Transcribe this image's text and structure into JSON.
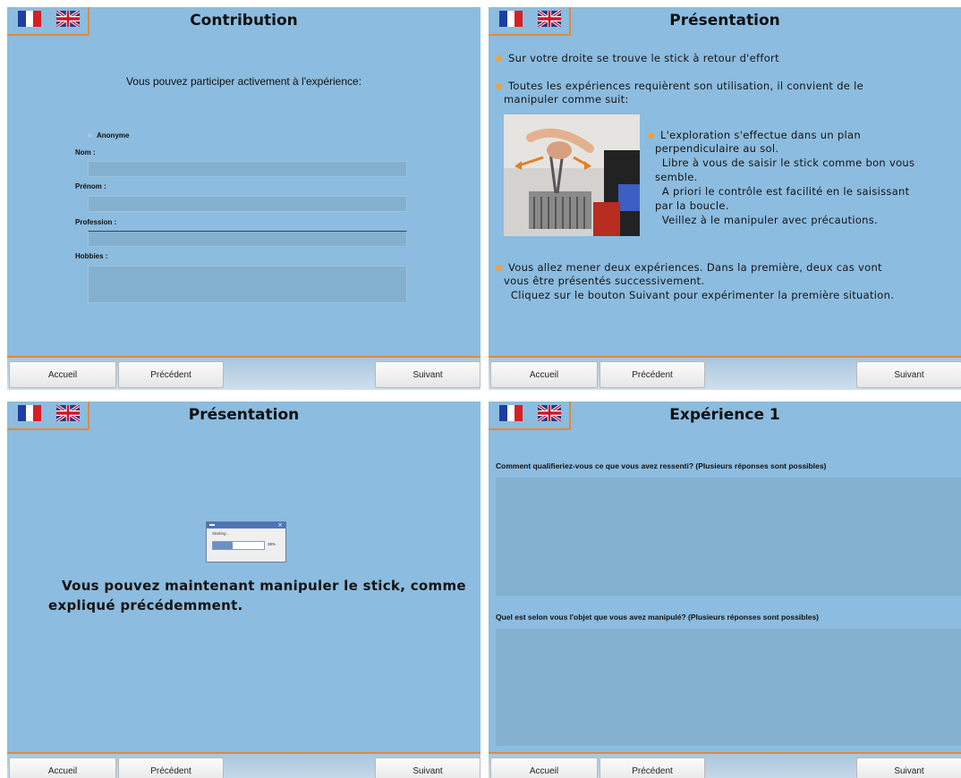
{
  "nav": {
    "home": "Accueil",
    "previous": "Précédent",
    "next": "Suivant"
  },
  "panel_contribution": {
    "title": "Contribution",
    "intro": "Vous pouvez participer activement à l'expérience:",
    "anonymous_label": "Anonyme",
    "last_name_label": "Nom :",
    "first_name_label": "Prénom :",
    "profession_label": "Profession :",
    "hobbies_label": "Hobbies :"
  },
  "panel_presentation": {
    "title": "Présentation",
    "bullet1": "Sur votre droite se trouve le stick à retour d'effort",
    "bullet2_l1": "Toutes les expériences requièrent son utilisation, il convient de le",
    "bullet2_l2": "manipuler comme suit:",
    "sub_l1": "L'exploration s'effectue dans un plan",
    "sub_l2": "perpendiculaire au sol.",
    "sub_l3": "  Libre à vous de saisir le stick comme bon vous",
    "sub_l4": "semble.",
    "sub_l5": "  A priori le contrôle est facilité en le saisissant",
    "sub_l6": "par la boucle.",
    "sub_l7": "  Veillez à le manipuler avec précautions.",
    "bullet3_l1": "Vous allez mener deux expériences. Dans la première, deux cas vont",
    "bullet3_l2": "vous être présentés successivement.",
    "bullet3_l3": "  Cliquez sur le bouton Suivant pour expérimenter la première situation."
  },
  "panel_loading": {
    "title": "Présentation",
    "dialog_status": "Starting...",
    "progress_label": "38%",
    "progress": 0.38,
    "message_l1": "Vous pouvez maintenant manipuler le stick, comme",
    "message_l2": "expliqué précédemment."
  },
  "panel_experience": {
    "title": "Expérience 1",
    "question1": "Comment qualifieriez-vous ce que vous avez ressenti? (Plusieurs réponses sont possibles)",
    "question2": "Quel est selon vous l'objet que vous avez manipulé? (Plusieurs réponses sont possibles)"
  },
  "colors": {
    "panel_bg": "#8cbcdf",
    "accent": "#e08a3a",
    "field_bg": "#84b0d0"
  },
  "icons": {
    "french_flag": "flag-fr-icon",
    "english_flag": "flag-uk-icon",
    "bullet": "orange-dot-icon"
  }
}
